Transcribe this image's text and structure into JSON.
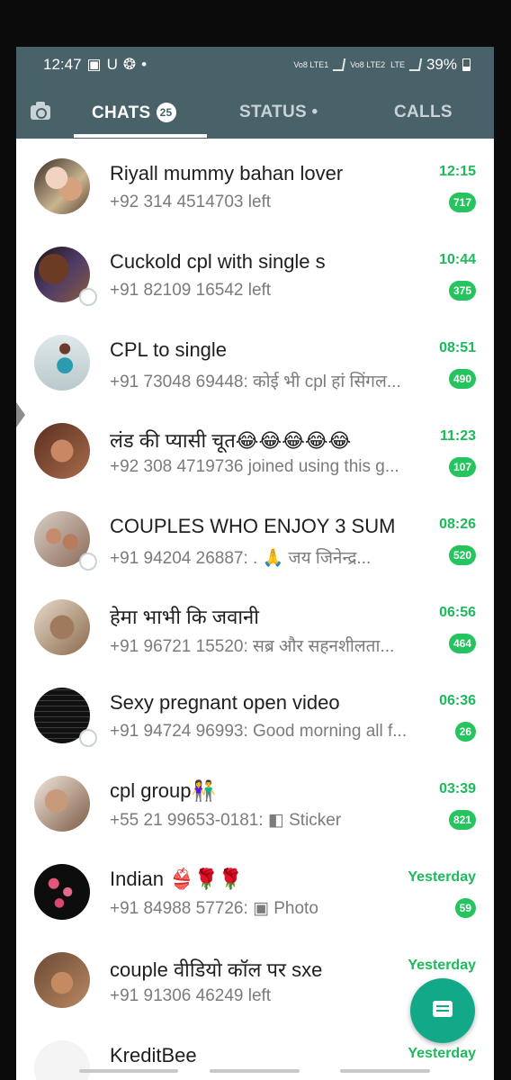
{
  "status_bar": {
    "time": "12:47",
    "left_icons": [
      "▣",
      "U",
      "❂",
      "•"
    ],
    "net1": "Vo8 LTE1",
    "net2": "Vo8 LTE2",
    "net3": "LTE",
    "battery": "39%"
  },
  "tabs": {
    "chats": "CHATS",
    "chats_badge": "25",
    "status": "STATUS •",
    "calls": "CALLS"
  },
  "chats": [
    {
      "name": "Riyall mummy bahan lover",
      "message": "+92 314 4514703 left",
      "time": "12:15",
      "unread": "717"
    },
    {
      "name": "Cuckold cpl with single s",
      "message": "+91 82109 16542 left",
      "time": "10:44",
      "unread": "375"
    },
    {
      "name": "CPL to single",
      "message": "+91 73048 69448: कोई भी cpl हां सिंगल...",
      "time": "08:51",
      "unread": "490"
    },
    {
      "name": "लंड की प्यासी चूत😂😂😂😂😂",
      "message": "+92 308 4719736 joined using this g...",
      "time": "11:23",
      "unread": "107"
    },
    {
      "name": "COUPLES WHO ENJOY 3 SUM",
      "message": "+91 94204 26887: .    🙏 जय जिनेन्द्र...",
      "time": "08:26",
      "unread": "520"
    },
    {
      "name": "हेमा भाभी कि जवानी",
      "message": "+91 96721 15520: सब्र और सहनशीलता...",
      "time": "06:56",
      "unread": "464"
    },
    {
      "name": "Sexy pregnant open video",
      "message": "+91 94724 96993: Good morning all f...",
      "time": "06:36",
      "unread": "26"
    },
    {
      "name": "cpl group👫",
      "message": "+55 21 99653-0181: ◧ Sticker",
      "time": "03:39",
      "unread": "821"
    },
    {
      "name": "Indian 👙🌹🌹",
      "message": "+91 84988 57726: ▣ Photo",
      "time": "Yesterday",
      "unread": "59"
    },
    {
      "name": "couple वीडियो कॉल पर sxe",
      "message": "+91 91306 46249 left",
      "time": "Yesterday",
      "unread": ""
    },
    {
      "name": "KreditBee",
      "message": "",
      "time": "Yesterday",
      "unread": ""
    }
  ],
  "colors": {
    "header": "#496168",
    "accent": "#25c45f",
    "fab": "#12a989"
  },
  "icons": {
    "camera": "camera-icon",
    "fab": "new-chat-icon"
  }
}
